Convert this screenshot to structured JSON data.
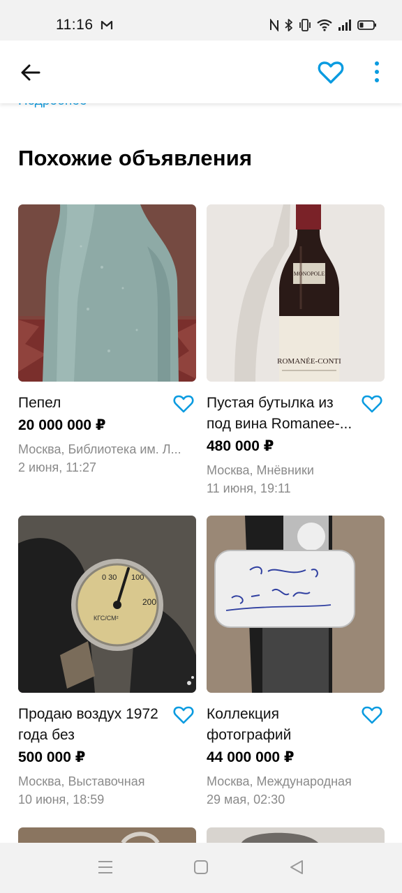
{
  "status_bar": {
    "time": "11:16"
  },
  "header": {
    "back_icon": "arrow-left-icon",
    "favorite_icon": "heart-outline-icon",
    "more_icon": "more-vertical-icon",
    "accent_color": "#0a9be0"
  },
  "details_link": "Подробнее",
  "section_title": "Похожие объявления",
  "listings": [
    {
      "title": "Пепел",
      "price": "20 000 000 ₽",
      "location": "Москва, Библиотека им. Л...",
      "date": "2 июня, 11:27"
    },
    {
      "title": "Пустая бутылка из под вина Romanee-...",
      "price": "480 000 ₽",
      "location": "Москва, Мнёвники",
      "date": "11 июня, 19:11"
    },
    {
      "title": "Продаю воздух 1972 года без",
      "price": "500 000 ₽",
      "location": "Москва, Выставочная",
      "date": "10 июня, 18:59"
    },
    {
      "title": "Коллекция фотографий",
      "price": "44 000 000 ₽",
      "location": "Москва, Международная",
      "date": "29 мая, 02:30"
    }
  ],
  "nav_bar": {
    "menu_icon": "menu-icon",
    "home_icon": "square-home-icon",
    "back_icon": "triangle-back-icon"
  }
}
